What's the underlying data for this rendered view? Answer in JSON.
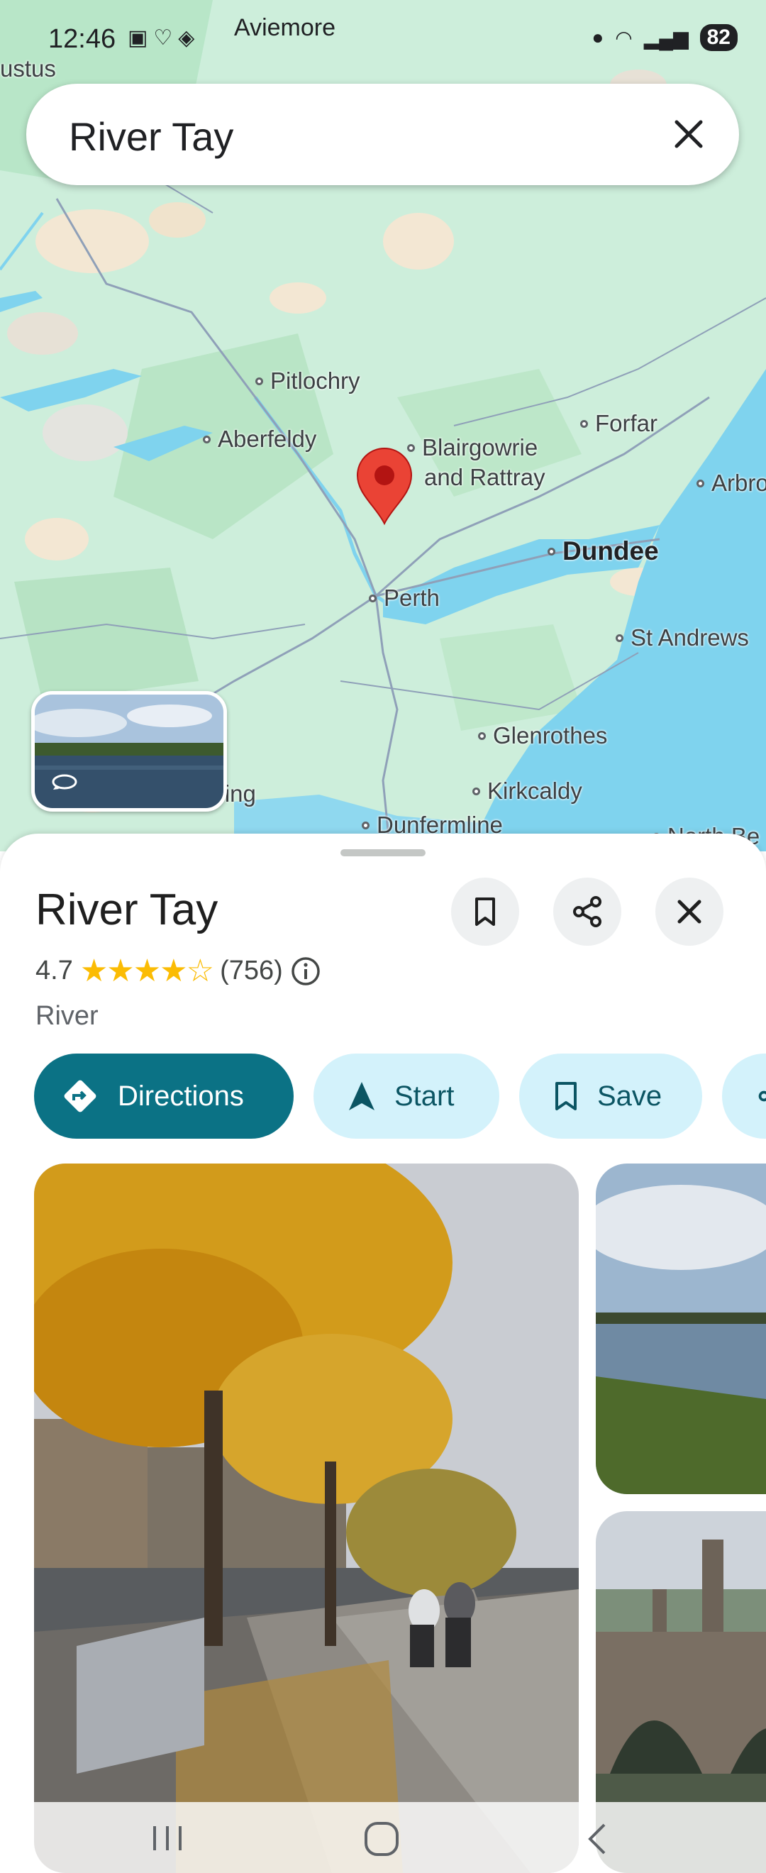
{
  "status_bar": {
    "time": "12:46",
    "location_label": "Aviemore",
    "battery": "82"
  },
  "search": {
    "query": "River Tay"
  },
  "map": {
    "places": {
      "ustus": "ustus",
      "pitlochry": "Pitlochry",
      "aberfeldy": "Aberfeldy",
      "blairgowrie": "Blairgowrie",
      "rattray": "and Rattray",
      "forfar": "Forfar",
      "arbroath": "Arbro",
      "dundee": "Dundee",
      "perth": "Perth",
      "st_andrews": "St Andrews",
      "glenrothes": "Glenrothes",
      "kirkcaldy": "Kirkcaldy",
      "dunfermline": "Dunfermline",
      "stirling": "Stirling",
      "north_berwick": "North Be"
    }
  },
  "place": {
    "name": "River Tay",
    "rating": "4.7",
    "stars": "★★★★☆",
    "review_count": "(756)",
    "category": "River"
  },
  "actions": {
    "directions": "Directions",
    "start": "Start",
    "save": "Save"
  },
  "colors": {
    "accent": "#0b7285",
    "chip_bg": "#d3f2fb",
    "marker": "#ea4335",
    "water": "#7fd3ee",
    "land": "#cfeedd"
  }
}
